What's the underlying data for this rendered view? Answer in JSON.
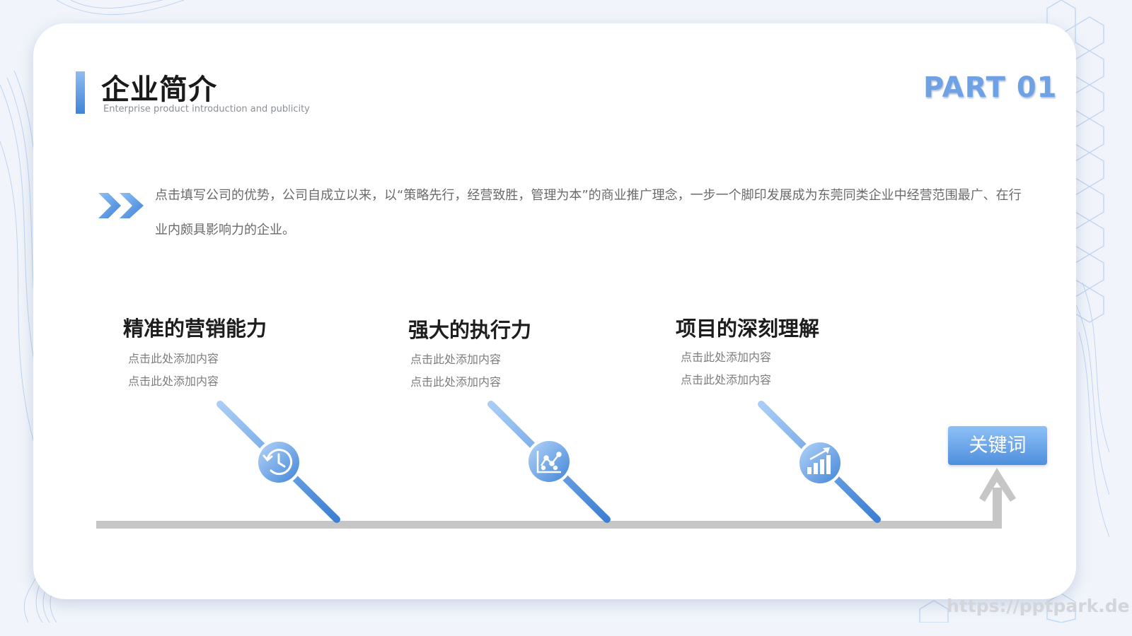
{
  "header": {
    "title": "企业简介",
    "subtitle": "Enterprise product introduction and publicity",
    "part_label": "PART 01"
  },
  "intro": {
    "text": "点击填写公司的优势，公司自成立以来，以“策略先行，经营致胜，管理为本”的商业推广理念，一步一个脚印发展成为东莞同类企业中经营范围最广、在行业内颇具影响力的企业。"
  },
  "features": [
    {
      "title": "精准的营销能力",
      "line1": "点击此处添加内容",
      "line2": "点击此处添加内容",
      "icon": "history-clock-icon"
    },
    {
      "title": "强大的执行力",
      "line1": "点击此处添加内容",
      "line2": "点击此处添加内容",
      "icon": "scatter-chart-icon"
    },
    {
      "title": "项目的深刻理解",
      "line1": "点击此处添加内容",
      "line2": "点击此处添加内容",
      "icon": "growth-bar-chart-icon"
    }
  ],
  "keyword": {
    "label": "关键词"
  },
  "watermark": {
    "text": "https://pptpark.de"
  },
  "colors": {
    "accent": "#5b95de",
    "accent_light": "#9cc4f3",
    "timeline_gray": "#c6c6c6",
    "title_text": "#1d1d1d",
    "body_text": "#6a6a6a"
  }
}
